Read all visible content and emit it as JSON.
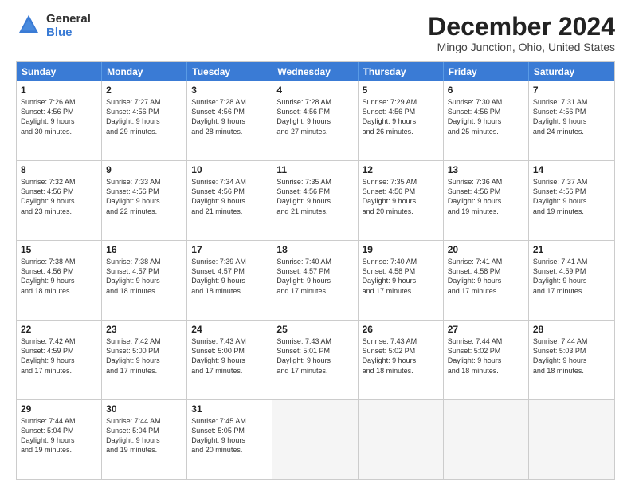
{
  "logo": {
    "general": "General",
    "blue": "Blue"
  },
  "title": "December 2024",
  "subtitle": "Mingo Junction, Ohio, United States",
  "days": [
    "Sunday",
    "Monday",
    "Tuesday",
    "Wednesday",
    "Thursday",
    "Friday",
    "Saturday"
  ],
  "rows": [
    [
      {
        "day": "1",
        "text": "Sunrise: 7:26 AM\nSunset: 4:56 PM\nDaylight: 9 hours\nand 30 minutes."
      },
      {
        "day": "2",
        "text": "Sunrise: 7:27 AM\nSunset: 4:56 PM\nDaylight: 9 hours\nand 29 minutes."
      },
      {
        "day": "3",
        "text": "Sunrise: 7:28 AM\nSunset: 4:56 PM\nDaylight: 9 hours\nand 28 minutes."
      },
      {
        "day": "4",
        "text": "Sunrise: 7:28 AM\nSunset: 4:56 PM\nDaylight: 9 hours\nand 27 minutes."
      },
      {
        "day": "5",
        "text": "Sunrise: 7:29 AM\nSunset: 4:56 PM\nDaylight: 9 hours\nand 26 minutes."
      },
      {
        "day": "6",
        "text": "Sunrise: 7:30 AM\nSunset: 4:56 PM\nDaylight: 9 hours\nand 25 minutes."
      },
      {
        "day": "7",
        "text": "Sunrise: 7:31 AM\nSunset: 4:56 PM\nDaylight: 9 hours\nand 24 minutes."
      }
    ],
    [
      {
        "day": "8",
        "text": "Sunrise: 7:32 AM\nSunset: 4:56 PM\nDaylight: 9 hours\nand 23 minutes."
      },
      {
        "day": "9",
        "text": "Sunrise: 7:33 AM\nSunset: 4:56 PM\nDaylight: 9 hours\nand 22 minutes."
      },
      {
        "day": "10",
        "text": "Sunrise: 7:34 AM\nSunset: 4:56 PM\nDaylight: 9 hours\nand 21 minutes."
      },
      {
        "day": "11",
        "text": "Sunrise: 7:35 AM\nSunset: 4:56 PM\nDaylight: 9 hours\nand 21 minutes."
      },
      {
        "day": "12",
        "text": "Sunrise: 7:35 AM\nSunset: 4:56 PM\nDaylight: 9 hours\nand 20 minutes."
      },
      {
        "day": "13",
        "text": "Sunrise: 7:36 AM\nSunset: 4:56 PM\nDaylight: 9 hours\nand 19 minutes."
      },
      {
        "day": "14",
        "text": "Sunrise: 7:37 AM\nSunset: 4:56 PM\nDaylight: 9 hours\nand 19 minutes."
      }
    ],
    [
      {
        "day": "15",
        "text": "Sunrise: 7:38 AM\nSunset: 4:56 PM\nDaylight: 9 hours\nand 18 minutes."
      },
      {
        "day": "16",
        "text": "Sunrise: 7:38 AM\nSunset: 4:57 PM\nDaylight: 9 hours\nand 18 minutes."
      },
      {
        "day": "17",
        "text": "Sunrise: 7:39 AM\nSunset: 4:57 PM\nDaylight: 9 hours\nand 18 minutes."
      },
      {
        "day": "18",
        "text": "Sunrise: 7:40 AM\nSunset: 4:57 PM\nDaylight: 9 hours\nand 17 minutes."
      },
      {
        "day": "19",
        "text": "Sunrise: 7:40 AM\nSunset: 4:58 PM\nDaylight: 9 hours\nand 17 minutes."
      },
      {
        "day": "20",
        "text": "Sunrise: 7:41 AM\nSunset: 4:58 PM\nDaylight: 9 hours\nand 17 minutes."
      },
      {
        "day": "21",
        "text": "Sunrise: 7:41 AM\nSunset: 4:59 PM\nDaylight: 9 hours\nand 17 minutes."
      }
    ],
    [
      {
        "day": "22",
        "text": "Sunrise: 7:42 AM\nSunset: 4:59 PM\nDaylight: 9 hours\nand 17 minutes."
      },
      {
        "day": "23",
        "text": "Sunrise: 7:42 AM\nSunset: 5:00 PM\nDaylight: 9 hours\nand 17 minutes."
      },
      {
        "day": "24",
        "text": "Sunrise: 7:43 AM\nSunset: 5:00 PM\nDaylight: 9 hours\nand 17 minutes."
      },
      {
        "day": "25",
        "text": "Sunrise: 7:43 AM\nSunset: 5:01 PM\nDaylight: 9 hours\nand 17 minutes."
      },
      {
        "day": "26",
        "text": "Sunrise: 7:43 AM\nSunset: 5:02 PM\nDaylight: 9 hours\nand 18 minutes."
      },
      {
        "day": "27",
        "text": "Sunrise: 7:44 AM\nSunset: 5:02 PM\nDaylight: 9 hours\nand 18 minutes."
      },
      {
        "day": "28",
        "text": "Sunrise: 7:44 AM\nSunset: 5:03 PM\nDaylight: 9 hours\nand 18 minutes."
      }
    ],
    [
      {
        "day": "29",
        "text": "Sunrise: 7:44 AM\nSunset: 5:04 PM\nDaylight: 9 hours\nand 19 minutes."
      },
      {
        "day": "30",
        "text": "Sunrise: 7:44 AM\nSunset: 5:04 PM\nDaylight: 9 hours\nand 19 minutes."
      },
      {
        "day": "31",
        "text": "Sunrise: 7:45 AM\nSunset: 5:05 PM\nDaylight: 9 hours\nand 20 minutes."
      },
      {
        "day": "",
        "text": ""
      },
      {
        "day": "",
        "text": ""
      },
      {
        "day": "",
        "text": ""
      },
      {
        "day": "",
        "text": ""
      }
    ]
  ]
}
